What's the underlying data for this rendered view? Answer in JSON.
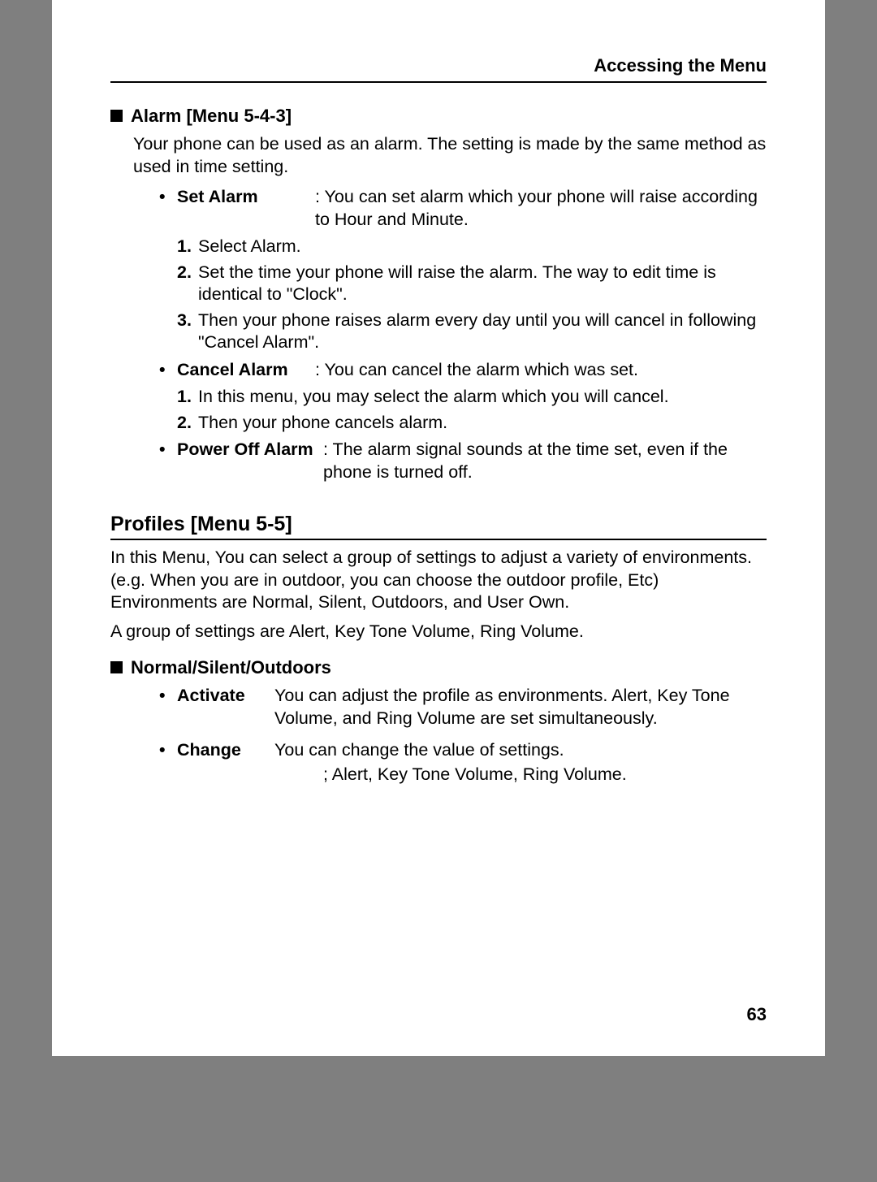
{
  "header": "Accessing the Menu",
  "alarm": {
    "title": "Alarm [Menu 5-4-3]",
    "intro": "Your phone can be used as an alarm. The setting is made by the same method as used in time setting.",
    "setAlarm": {
      "label": "Set Alarm",
      "desc": ": You can set alarm which your phone will raise according to Hour and Minute.",
      "steps": [
        "Select Alarm.",
        "Set the time your phone will raise the alarm. The way to edit time is identical to \"Clock\".",
        "Then your phone raises alarm every day until you will cancel in following \"Cancel Alarm\"."
      ]
    },
    "cancelAlarm": {
      "label": "Cancel Alarm",
      "desc": ": You can cancel the alarm which was set.",
      "steps": [
        "In this menu, you may select the alarm which you will cancel.",
        "Then your phone cancels alarm."
      ]
    },
    "powerOff": {
      "label": "Power Off Alarm",
      "desc": ": The alarm signal sounds at the time set, even if the phone is turned off."
    }
  },
  "profiles": {
    "title": "Profiles [Menu 5-5]",
    "para1": "In this Menu, You can select a group of settings to adjust a variety of environments. (e.g. When you are in outdoor, you can choose the outdoor profile, Etc) Environments are Normal, Silent, Outdoors, and User Own.",
    "para2": "A group of settings are Alert, Key Tone Volume, Ring Volume.",
    "sub": {
      "title": "Normal/Silent/Outdoors",
      "activate": {
        "label": "Activate",
        "desc": "You can adjust the profile as environments. Alert, Key Tone Volume, and Ring Volume are set simultaneously."
      },
      "change": {
        "label": "Change",
        "desc1": "You can change the value of settings.",
        "desc2": "; Alert, Key Tone Volume, Ring Volume."
      }
    }
  },
  "pageNumber": "63"
}
